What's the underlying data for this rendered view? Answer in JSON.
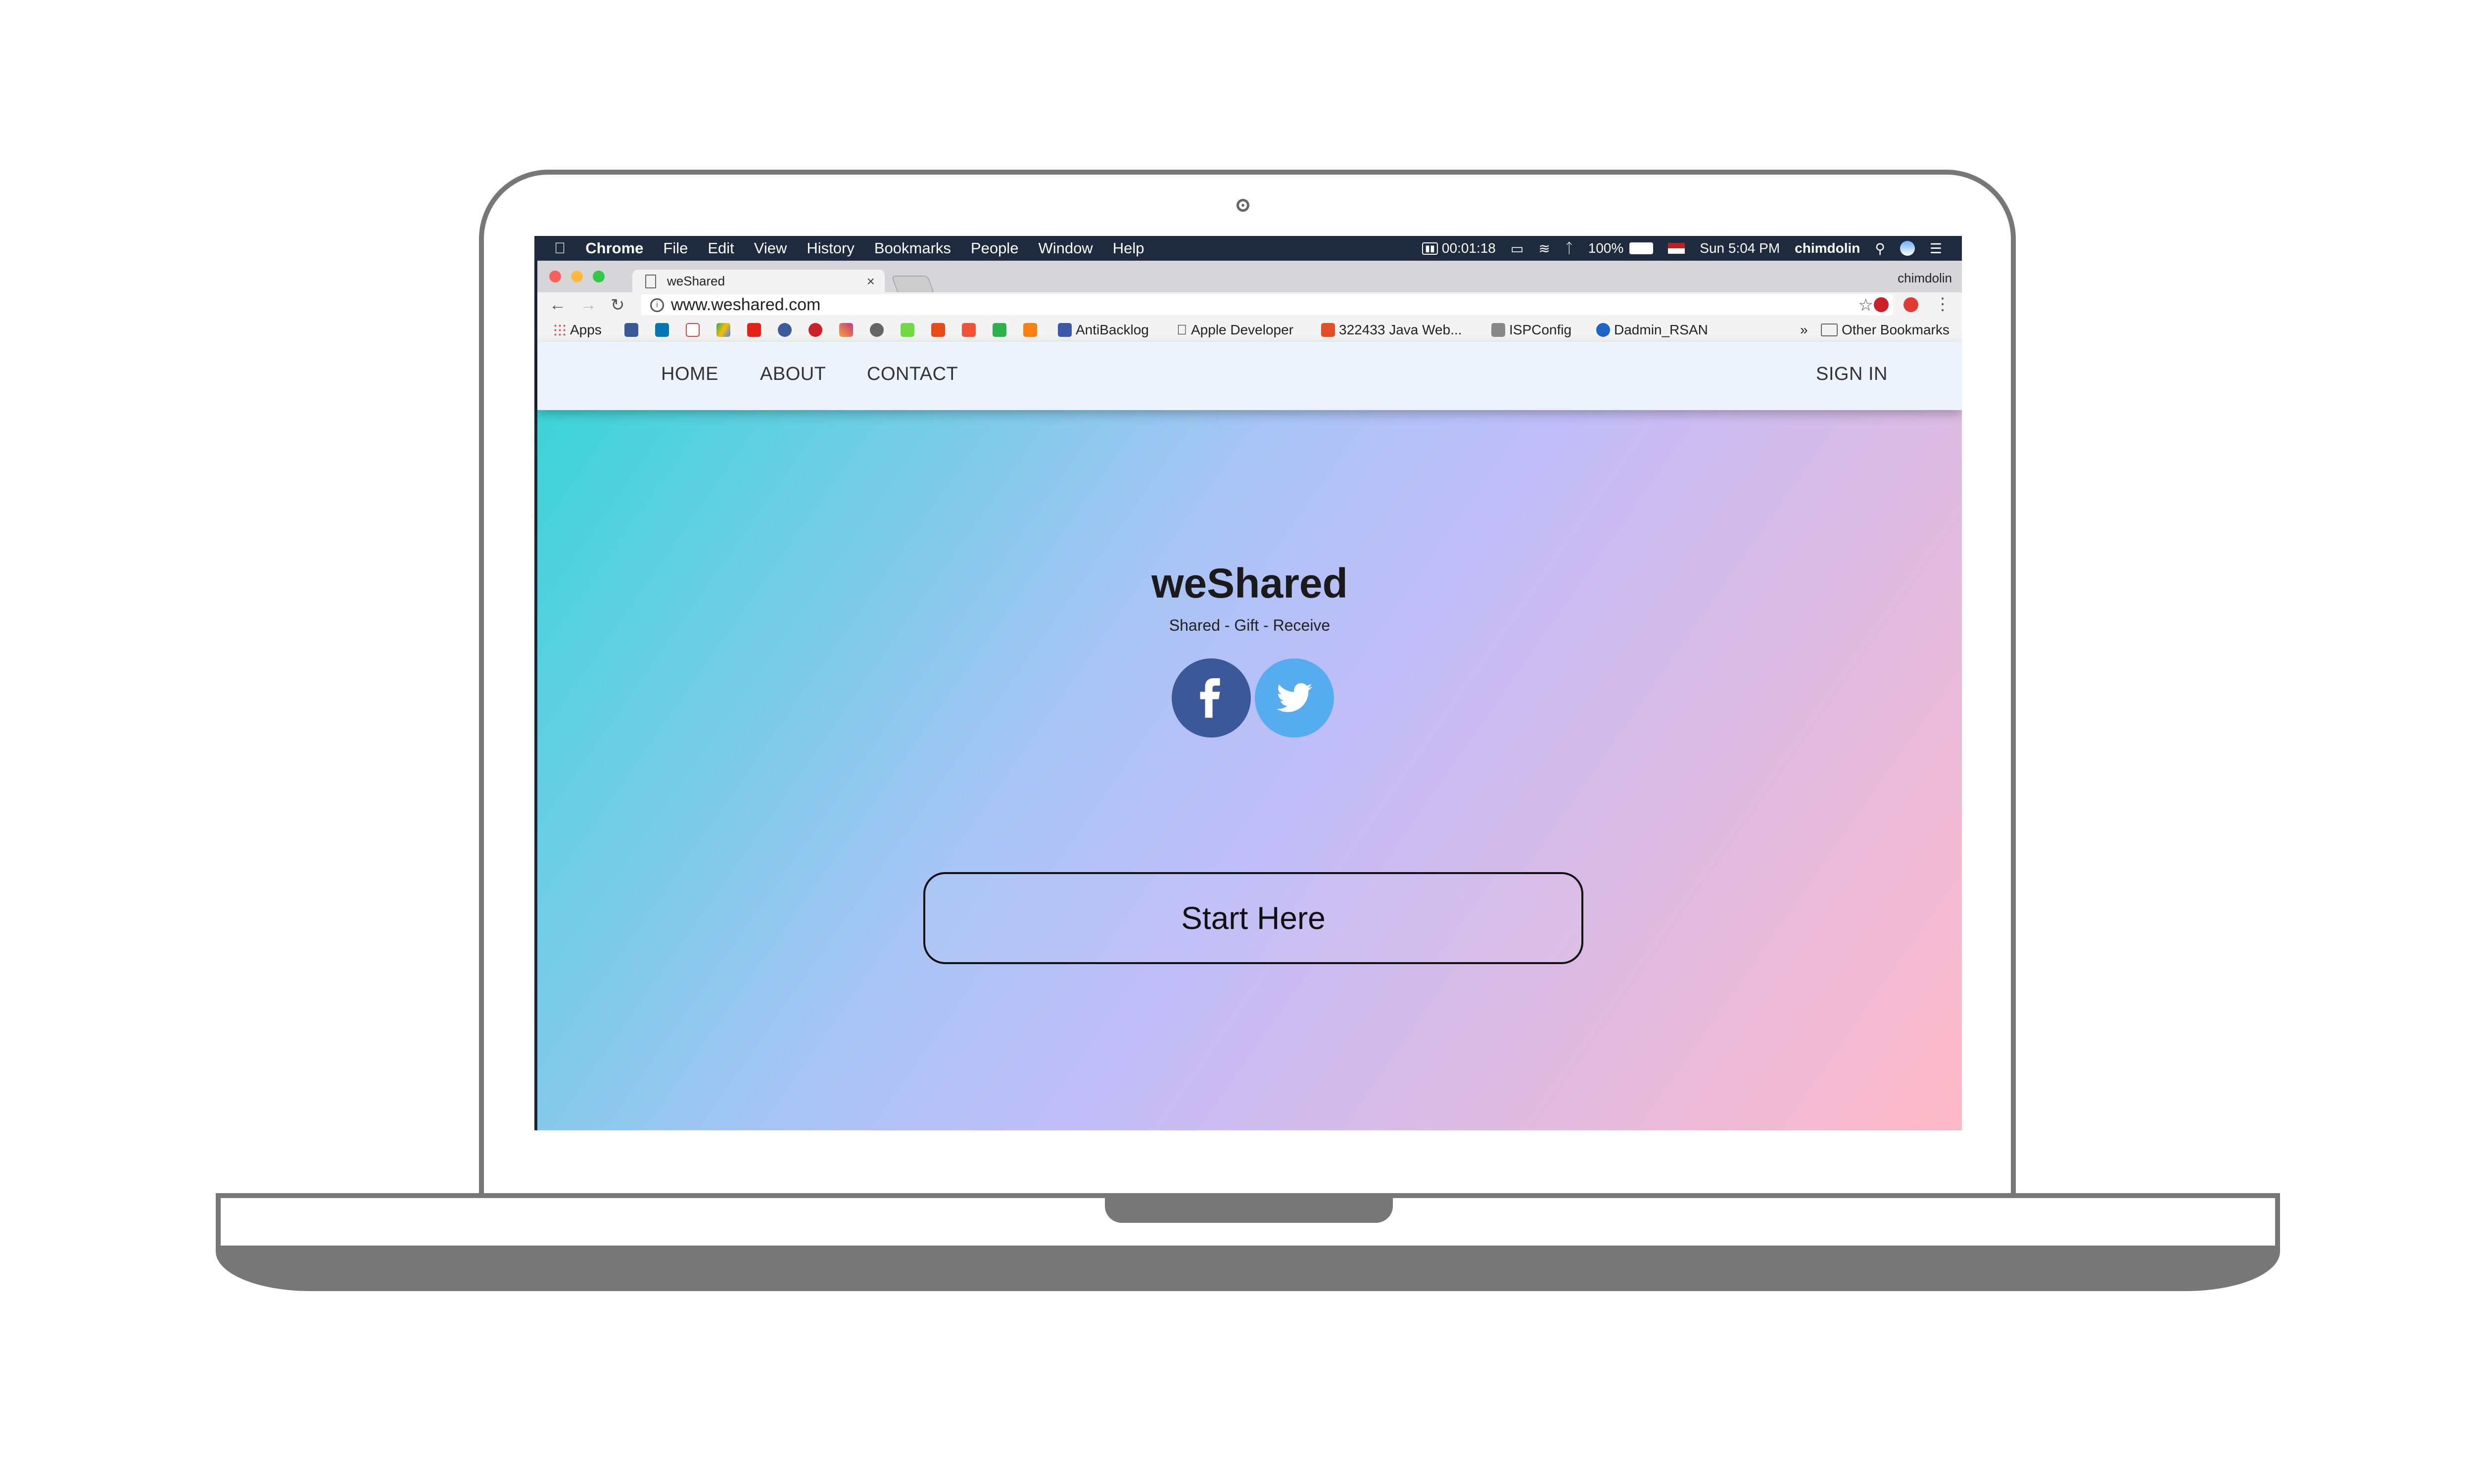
{
  "menubar": {
    "apple_icon": "apple-icon",
    "app_name": "Chrome",
    "items": [
      "File",
      "Edit",
      "View",
      "History",
      "Bookmarks",
      "People",
      "Window",
      "Help"
    ],
    "timer": "00:01:18",
    "battery": "100%",
    "clock": "Sun 5:04 PM",
    "user": "chimdolin"
  },
  "browser": {
    "tab_title": "weShared",
    "profile": "chimdolin",
    "url": "www.weshared.com",
    "bookmarks": [
      "Apps",
      "AntiBacklog",
      "Apple Developer",
      "322433 Java Web...",
      "ISPConfig",
      "Dadmin_RSAN"
    ],
    "other_bookmarks": "Other Bookmarks",
    "more": "»"
  },
  "site": {
    "nav": [
      "HOME",
      "ABOUT",
      "CONTACT"
    ],
    "sign_in": "SIGN IN",
    "title": "weShared",
    "tagline": "Shared - Gift - Receive",
    "cta": "Start Here",
    "colors": {
      "facebook": "#3b5998",
      "twitter": "#55acee",
      "gradient_start": "#35d6d6",
      "gradient_mid": "#c2bdf8",
      "gradient_end": "#ffb9c8",
      "navbar_bg": "#ecf3fd"
    }
  }
}
